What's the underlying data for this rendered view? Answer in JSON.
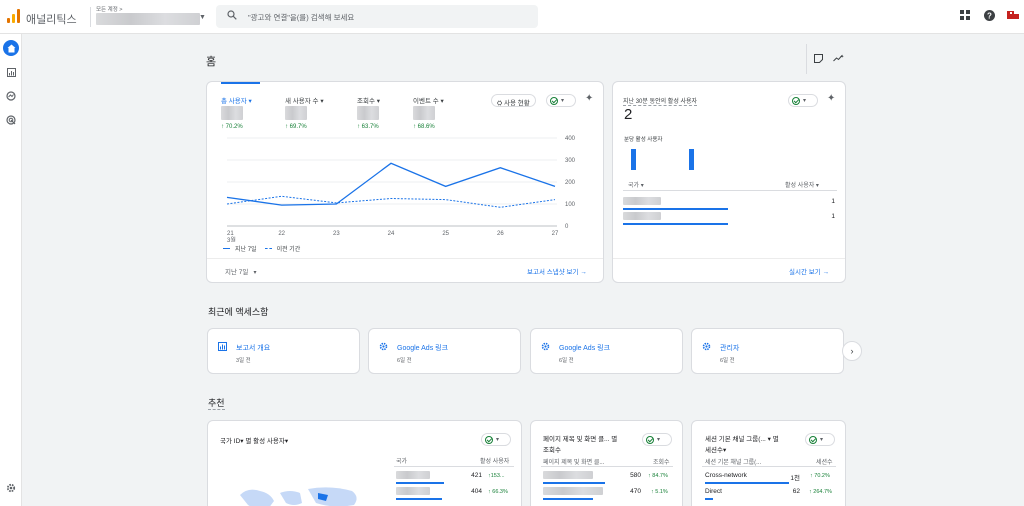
{
  "app": {
    "title": "애널리틱스",
    "account_label": "모든 계정 >"
  },
  "search": {
    "placeholder": "\"광고와 연결\"을(를) 검색해 보세요"
  },
  "home": {
    "title": "홈"
  },
  "overview": {
    "metrics": [
      {
        "label": "총 사용자 ▾",
        "change": "↑ 70.2%"
      },
      {
        "label": "새 사용자 수 ▾",
        "change": "↑ 69.7%"
      },
      {
        "label": "조회수 ▾",
        "change": "↑ 63.7%"
      },
      {
        "label": "이벤트 수 ▾",
        "change": "↑ 68.6%"
      }
    ],
    "compare_button": "사용 현황",
    "legend_current": "지난 7일",
    "legend_previous": "이전 기간",
    "date_range": "지난 7일",
    "footer_link": "보고서 스냅샷 보기 →"
  },
  "chart_data": {
    "type": "line",
    "x": [
      "21",
      "22",
      "23",
      "24",
      "25",
      "26",
      "27"
    ],
    "x_sublabel": "3월",
    "yticks": [
      "400",
      "300",
      "200",
      "100",
      "0"
    ],
    "ylim": [
      0,
      400
    ],
    "series": [
      {
        "name": "지난 7일",
        "values": [
          130,
          95,
          100,
          285,
          180,
          265,
          180
        ],
        "color": "#1a73e8",
        "style": "solid"
      },
      {
        "name": "이전 기간",
        "values": [
          100,
          135,
          105,
          125,
          120,
          85,
          120
        ],
        "color": "#1a73e8",
        "style": "dashed"
      }
    ]
  },
  "realtime": {
    "title": "지난 30분 동안의 활성 사용자",
    "value": "2",
    "per_minute_label": "분당 활성 사용자",
    "col_country": "국가 ▾",
    "col_users": "활성 사용자 ▾",
    "rows": [
      {
        "value": "1",
        "bar": 0.99
      },
      {
        "value": "1",
        "bar": 0.99
      }
    ],
    "footer_link": "실시간 보기 →"
  },
  "recent": {
    "title": "최근에 액세스함",
    "items": [
      {
        "title": "보고서 개요",
        "sub": "3일 전",
        "icon": "report-icon"
      },
      {
        "title": "Google Ads 링크",
        "sub": "6일 전",
        "icon": "gear-icon"
      },
      {
        "title": "Google Ads 링크",
        "sub": "6일 전",
        "icon": "gear-icon"
      },
      {
        "title": "관리자",
        "sub": "6일 전",
        "icon": "gear-icon"
      }
    ]
  },
  "recommend": {
    "title": "추천",
    "card1": {
      "title": "국가 ID▾ 별 활성 사용자▾",
      "col_country": "국가",
      "col_users": "활성 사용자",
      "rows": [
        {
          "value": "421",
          "change": "↑153..."
        },
        {
          "value": "404",
          "change": "↑ 66.3%"
        }
      ]
    },
    "card2": {
      "title": "페이지 제목 및 화면 클... 별",
      "title2": "조회수",
      "col_page": "페이지 제목 및 화면 클...",
      "col_views": "조회수",
      "rows": [
        {
          "value": "580",
          "change": "↑ 84.7%"
        },
        {
          "value": "470",
          "change": "↑ 5.1%"
        }
      ]
    },
    "card3": {
      "title": "세션 기본 채널 그룹(... ▾ 별",
      "title2": "세션수▾",
      "col_channel": "세션 기본 채널 그룹(...",
      "col_sessions": "세션수",
      "rows": [
        {
          "label": "Cross-network",
          "value": "1천",
          "change": "↑ 70.2%"
        },
        {
          "label": "Direct",
          "value": "62",
          "change": "↑ 264.7%"
        }
      ]
    }
  }
}
